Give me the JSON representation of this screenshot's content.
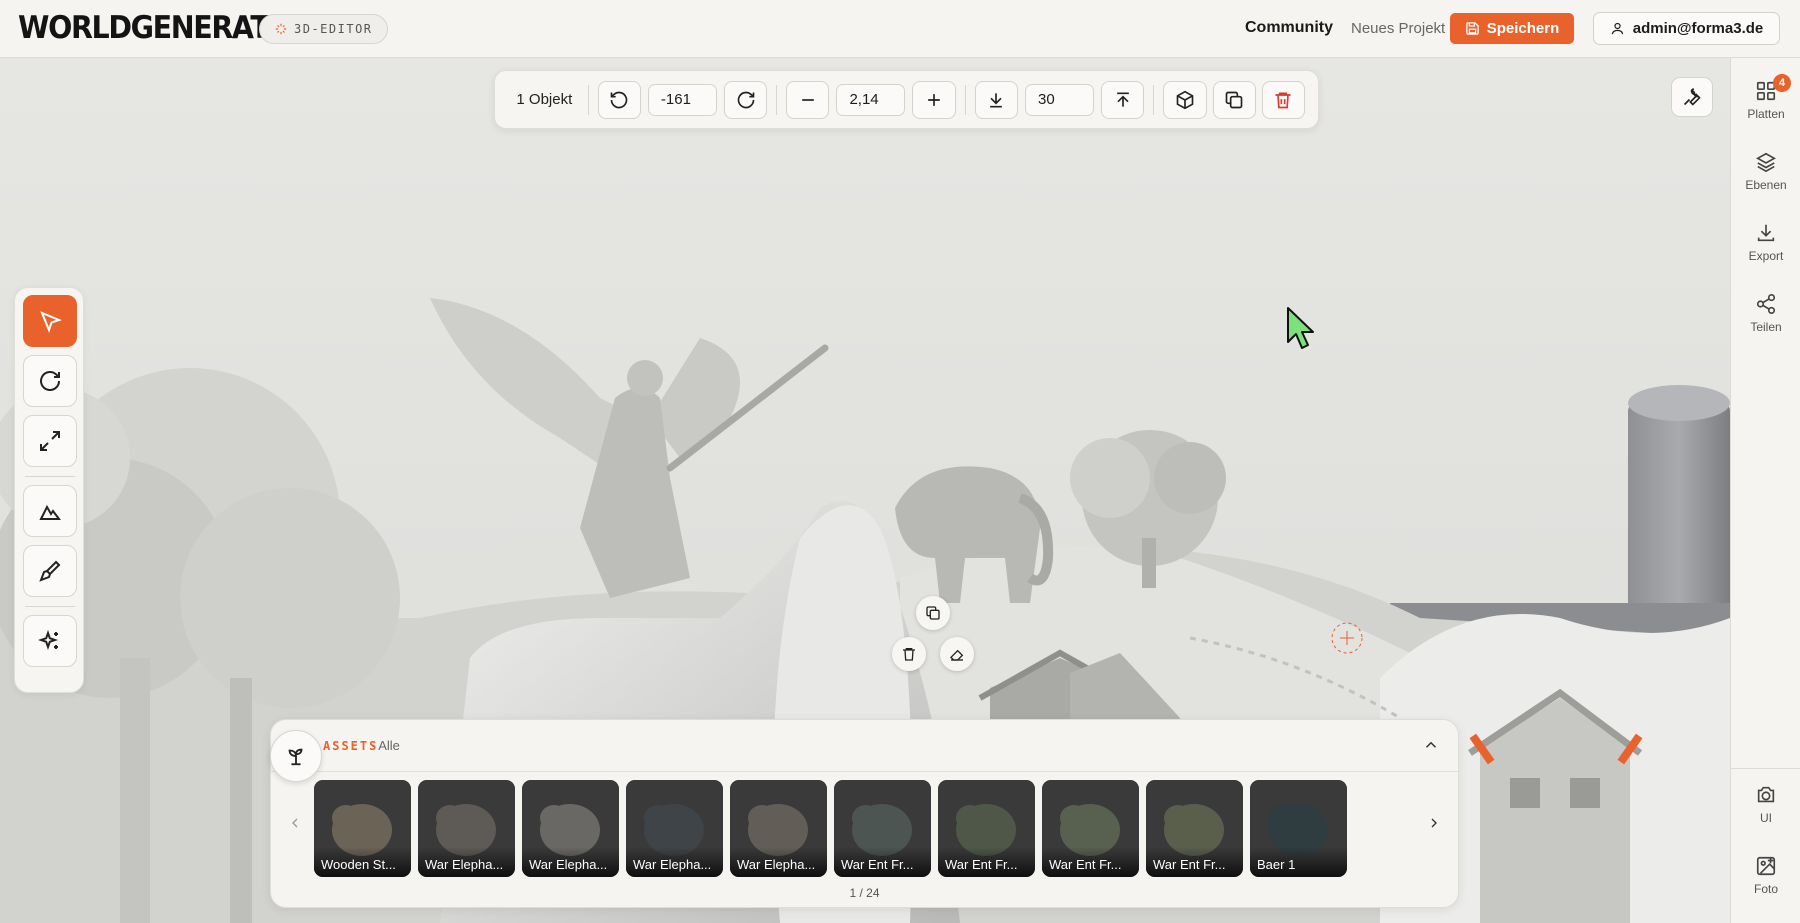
{
  "app": {
    "logo": "WORLDGENERATOR",
    "badge": "3D-EDITOR"
  },
  "header": {
    "community": "Community",
    "new_project": "Neues Projekt",
    "save": "Speichern",
    "user": "admin@forma3.de"
  },
  "toolbar": {
    "selection": "1 Objekt",
    "rotation": "-161",
    "scale": "2,14",
    "height": "30"
  },
  "sidebar": {
    "items": [
      {
        "label": "Platten",
        "icon": "grid-icon",
        "badge": "4"
      },
      {
        "label": "Ebenen",
        "icon": "layers-icon"
      },
      {
        "label": "Export",
        "icon": "download-icon"
      },
      {
        "label": "Teilen",
        "icon": "share-icon"
      }
    ],
    "bottom": [
      {
        "label": "UI",
        "icon": "camera-icon"
      },
      {
        "label": "Foto",
        "icon": "image-add-icon"
      }
    ]
  },
  "left_tools": [
    {
      "name": "select-tool",
      "icon": "cursor-icon",
      "active": true
    },
    {
      "name": "rotate-tool",
      "icon": "rotate-icon"
    },
    {
      "name": "scale-tool",
      "icon": "expand-icon"
    },
    {
      "name": "terrain-tool",
      "icon": "mountain-icon"
    },
    {
      "name": "paint-tool",
      "icon": "brush-icon"
    },
    {
      "name": "ai-tool",
      "icon": "sparkles-icon"
    }
  ],
  "assets": {
    "title": "ASSETS",
    "filter": "· Alle",
    "pager": "1 / 24",
    "items": [
      {
        "label": "Wooden St...",
        "tone": "#6b6356"
      },
      {
        "label": "War Elepha...",
        "tone": "#5e5a55"
      },
      {
        "label": "War Elepha...",
        "tone": "#6a6864"
      },
      {
        "label": "War Elepha...",
        "tone": "#3f4448"
      },
      {
        "label": "War Elepha...",
        "tone": "#625e57"
      },
      {
        "label": "War Ent Fr...",
        "tone": "#4d5552"
      },
      {
        "label": "War Ent Fr...",
        "tone": "#4f5848"
      },
      {
        "label": "War Ent Fr...",
        "tone": "#58604f"
      },
      {
        "label": "War Ent Fr...",
        "tone": "#5a5f4c"
      },
      {
        "label": "Baer 1",
        "tone": "#2f3c40"
      }
    ]
  },
  "colors": {
    "accent": "#e9622c",
    "danger": "#d93a2b",
    "background": "#e4e4e1",
    "panel": "#f5f4f1"
  }
}
